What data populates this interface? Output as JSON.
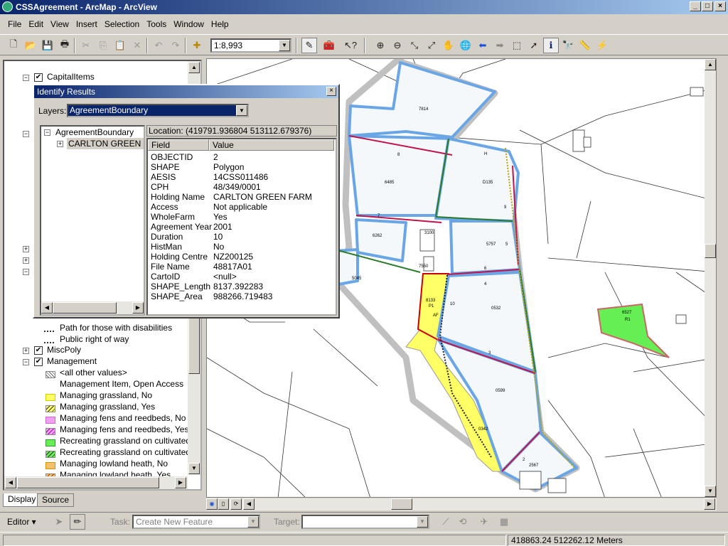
{
  "window": {
    "title": "CSSAgreement - ArcMap - ArcView",
    "min": "_",
    "max": "□",
    "close": "×"
  },
  "menus": [
    "File",
    "Edit",
    "View",
    "Insert",
    "Selection",
    "Tools",
    "Window",
    "Help"
  ],
  "toolbar": {
    "scale": "1:8,993"
  },
  "toc": {
    "rows": [
      {
        "label": "CapitalItems",
        "type": "layer",
        "checked": true,
        "expander": "⊟"
      },
      {
        "label": "Path for those with disabilities",
        "type": "legend",
        "swatch": "dot-line"
      },
      {
        "label": "Public right of way",
        "type": "legend",
        "swatch": "dot-line"
      },
      {
        "label": "MiscPoly",
        "type": "layer",
        "checked": true,
        "expander": "⊞"
      },
      {
        "label": "Management",
        "type": "layer",
        "checked": true,
        "expander": "⊟"
      },
      {
        "label": "<all other values>",
        "type": "legend",
        "swatch": "hatch-grey"
      },
      {
        "label": "Management Item, Open Access",
        "type": "legend",
        "swatch": "none"
      },
      {
        "label": "Managing grassland, No",
        "type": "legend",
        "swatch": "yellow"
      },
      {
        "label": "Managing grassland, Yes",
        "type": "legend",
        "swatch": "yellow-hatch"
      },
      {
        "label": "Managing fens and reedbeds, No",
        "type": "legend",
        "swatch": "pink"
      },
      {
        "label": "Managing fens and reedbeds, Yes",
        "type": "legend",
        "swatch": "pink-hatch"
      },
      {
        "label": "Recreating grassland on cultivated lar",
        "type": "legend",
        "swatch": "green"
      },
      {
        "label": "Recreating grassland on cultivated lar",
        "type": "legend",
        "swatch": "green-hatch"
      },
      {
        "label": "Managing lowland heath, No",
        "type": "legend",
        "swatch": "orange"
      },
      {
        "label": "Managing lowland heath, Yes",
        "type": "legend",
        "swatch": "orange-hatch"
      }
    ],
    "tabs": {
      "display": "Display",
      "source": "Source"
    }
  },
  "identify": {
    "title": "Identify Results",
    "layers_label": "Layers:",
    "layer_value": "AgreementBoundary",
    "tree_root": "AgreementBoundary",
    "tree_child": "CARLTON GREEN FA",
    "location": "Location: (419791.936804 513112.679376)",
    "columns": [
      "Field",
      "Value"
    ],
    "fields": [
      [
        "OBJECTID",
        "2"
      ],
      [
        "SHAPE",
        "Polygon"
      ],
      [
        "AESIS",
        "14CSS011486"
      ],
      [
        "CPH",
        "48/349/0001"
      ],
      [
        "Holding Name",
        "CARLTON GREEN FARM"
      ],
      [
        "Access",
        "Not applicable"
      ],
      [
        "WholeFarm",
        "Yes"
      ],
      [
        "Agreement Year",
        "2001"
      ],
      [
        "Duration",
        "10"
      ],
      [
        "HistMan",
        "No"
      ],
      [
        "Holding Centre",
        "NZ200125"
      ],
      [
        "File Name",
        "48817A01"
      ],
      [
        "CartoID",
        "<null>"
      ],
      [
        "SHAPE_Length",
        "8137.392283"
      ],
      [
        "SHAPE_Area",
        "988266.719483"
      ]
    ]
  },
  "map_labels": [
    "7814",
    "8",
    "6485",
    "D135",
    "H",
    "9",
    "7",
    "6262",
    "3100",
    "5757",
    "5",
    "7550",
    "6",
    "5045",
    "4",
    "0532",
    "8133",
    "P1",
    "AF",
    "10",
    "3",
    "0599",
    "0342",
    "2",
    "2567",
    "6527",
    "R1"
  ],
  "editor": {
    "label": "Editor ▾",
    "task_label": "Task:",
    "task_value": "Create New Feature",
    "target_label": "Target:"
  },
  "status": {
    "coords": "418863.24  512262.12 Meters"
  }
}
